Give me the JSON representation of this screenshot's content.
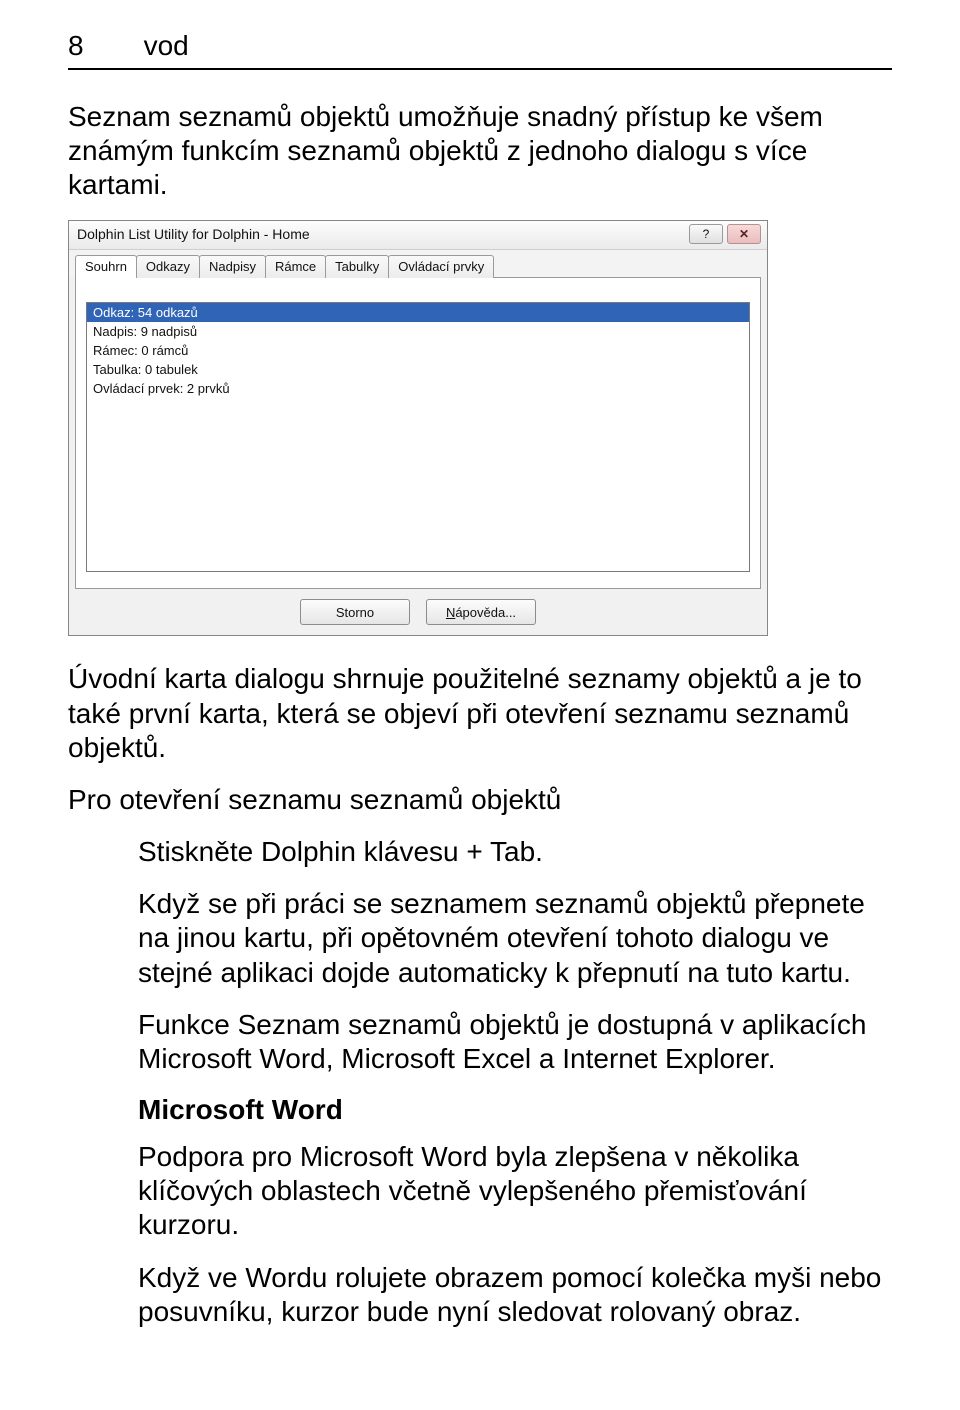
{
  "header": {
    "page_number": "8",
    "section": "vod"
  },
  "paras": {
    "p1": "Seznam seznamů objektů umožňuje snadný přístup ke všem známým funkcím seznamů objektů z jednoho dialogu s více kartami.",
    "p2": "Úvodní karta dialogu shrnuje použitelné seznamy objektů a je to také první karta, která se objeví při otevření seznamu seznamů objektů.",
    "p3_heading": "Pro otevření seznamu seznamů objektů",
    "p4": "Stiskněte Dolphin klávesu + Tab.",
    "p5": "Když se při práci se seznamem seznamů objektů přepnete na jinou kartu, při opětovném otevření tohoto dialogu ve stejné aplikaci dojde automaticky k přepnutí na tuto kartu.",
    "p6": "Funkce Seznam seznamů objektů je dostupná v aplikacích Microsoft Word, Microsoft Excel a Internet Explorer.",
    "p7_sub": "Microsoft Word",
    "p8": "Podpora pro Microsoft Word byla zlepšena v několika klíčových oblastech včetně vylepšeného přemisťování kurzoru.",
    "p9": "Když ve Wordu rolujete obrazem pomocí kolečka myši nebo posuvníku, kurzor bude nyní sledovat rolovaný obraz."
  },
  "dialog": {
    "title": "Dolphin List Utility for Dolphin - Home",
    "help_glyph": "?",
    "close_glyph": "✕",
    "tabs": [
      "Souhrn",
      "Odkazy",
      "Nadpisy",
      "Rámce",
      "Tabulky",
      "Ovládací prvky"
    ],
    "active_tab": 0,
    "list_items": [
      "Odkaz: 54 odkazů",
      "Nadpis: 9 nadpisů",
      "Rámec: 0 rámců",
      "Tabulka: 0 tabulek",
      "Ovládací prvek: 2 prvků"
    ],
    "selected_index": 0,
    "buttons": {
      "storno": "Storno",
      "napoveda_prefix": "N",
      "napoveda_rest": "ápověda..."
    }
  }
}
